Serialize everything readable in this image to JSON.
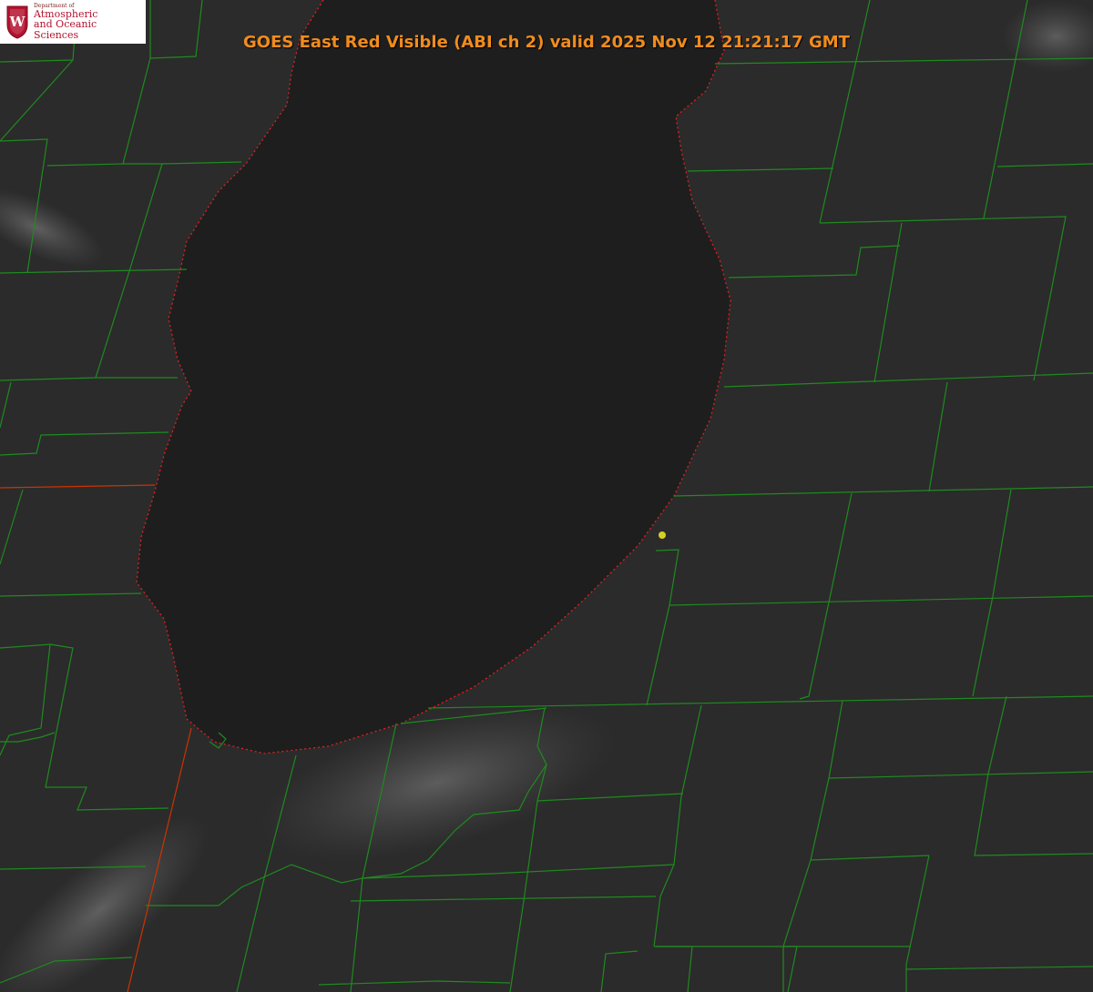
{
  "logo": {
    "dept_line": "Department of",
    "name_line1": "Atmospheric",
    "name_line2": "and Oceanic Sciences",
    "crest_letter": "W"
  },
  "title": "GOES East Red Visible (ABI ch 2) valid 2025 Nov 12 21:21:17 GMT",
  "colors": {
    "boundaries": "#1f8a1f",
    "state_line": "#cc3300",
    "shoreline_dots": "#e02020",
    "marker": "#d8d020",
    "title": "#f08c1e",
    "lake": "#1e1e1e",
    "land": "#2a2a2a"
  },
  "icons": {
    "crest": "university-crest-icon",
    "marker": "location-dot-icon"
  }
}
